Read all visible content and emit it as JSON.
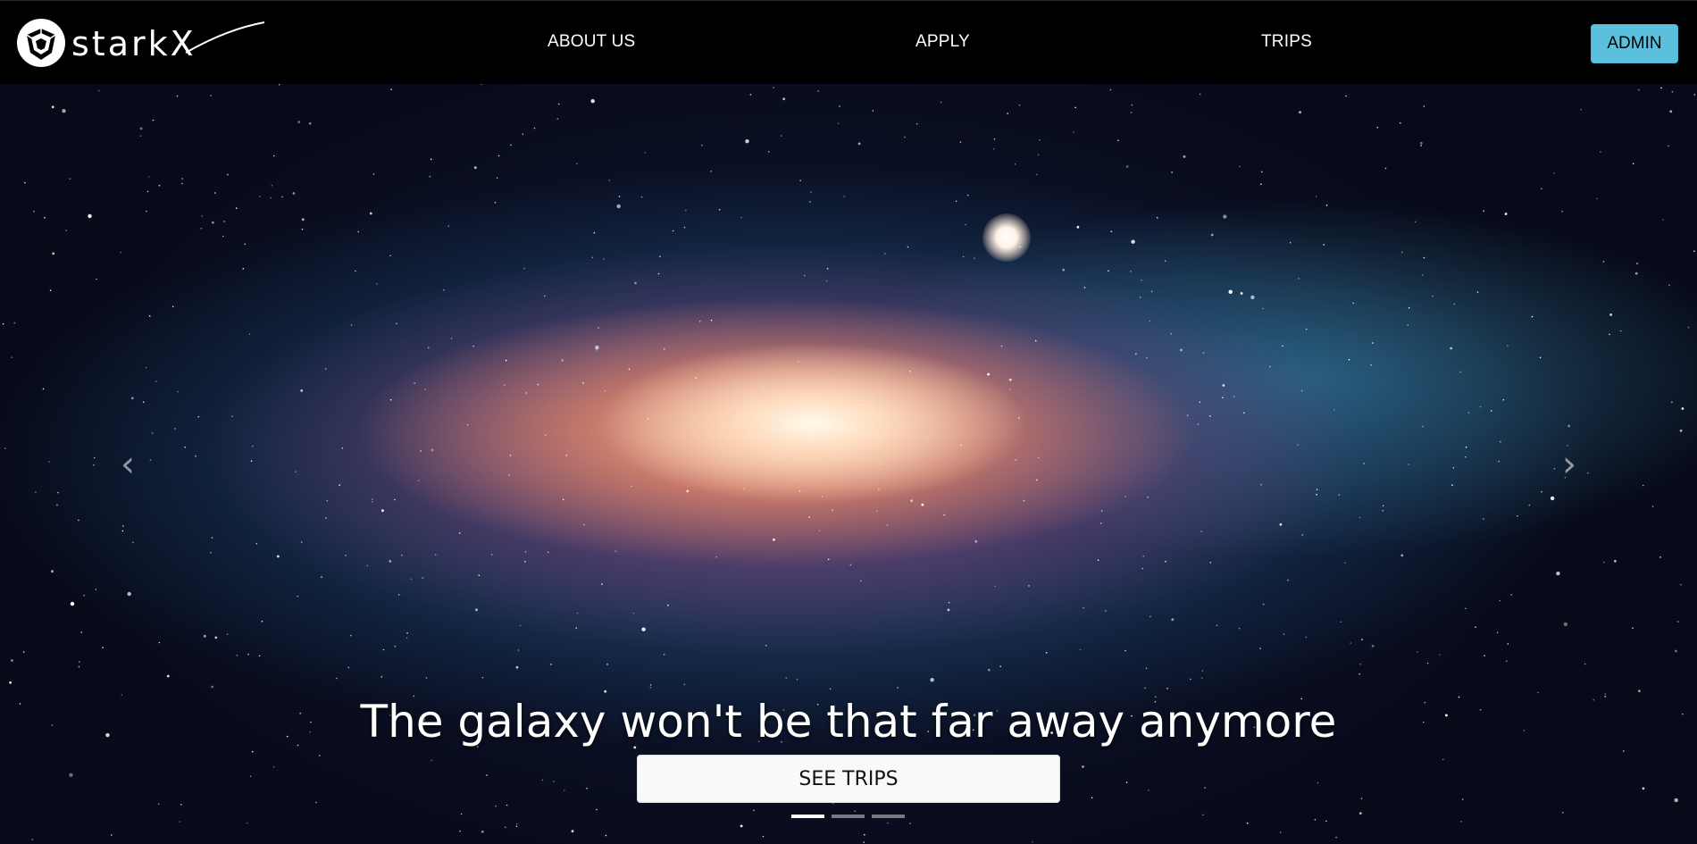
{
  "brand": {
    "logo_text": "starkX"
  },
  "nav": {
    "links": [
      {
        "label": "ABOUT US"
      },
      {
        "label": "APPLY"
      },
      {
        "label": "TRIPS"
      }
    ],
    "admin_label": "ADMIN"
  },
  "hero": {
    "caption": "The galaxy won't be that far away anymore",
    "cta_label": "SEE TRIPS",
    "prev_icon": "chevron-left-icon",
    "next_icon": "chevron-right-icon",
    "slide_count": 3,
    "active_slide": 1
  },
  "colors": {
    "nav_bg": "#000000",
    "admin_bg": "#5bc0de",
    "cta_bg": "#f8f9fa"
  }
}
